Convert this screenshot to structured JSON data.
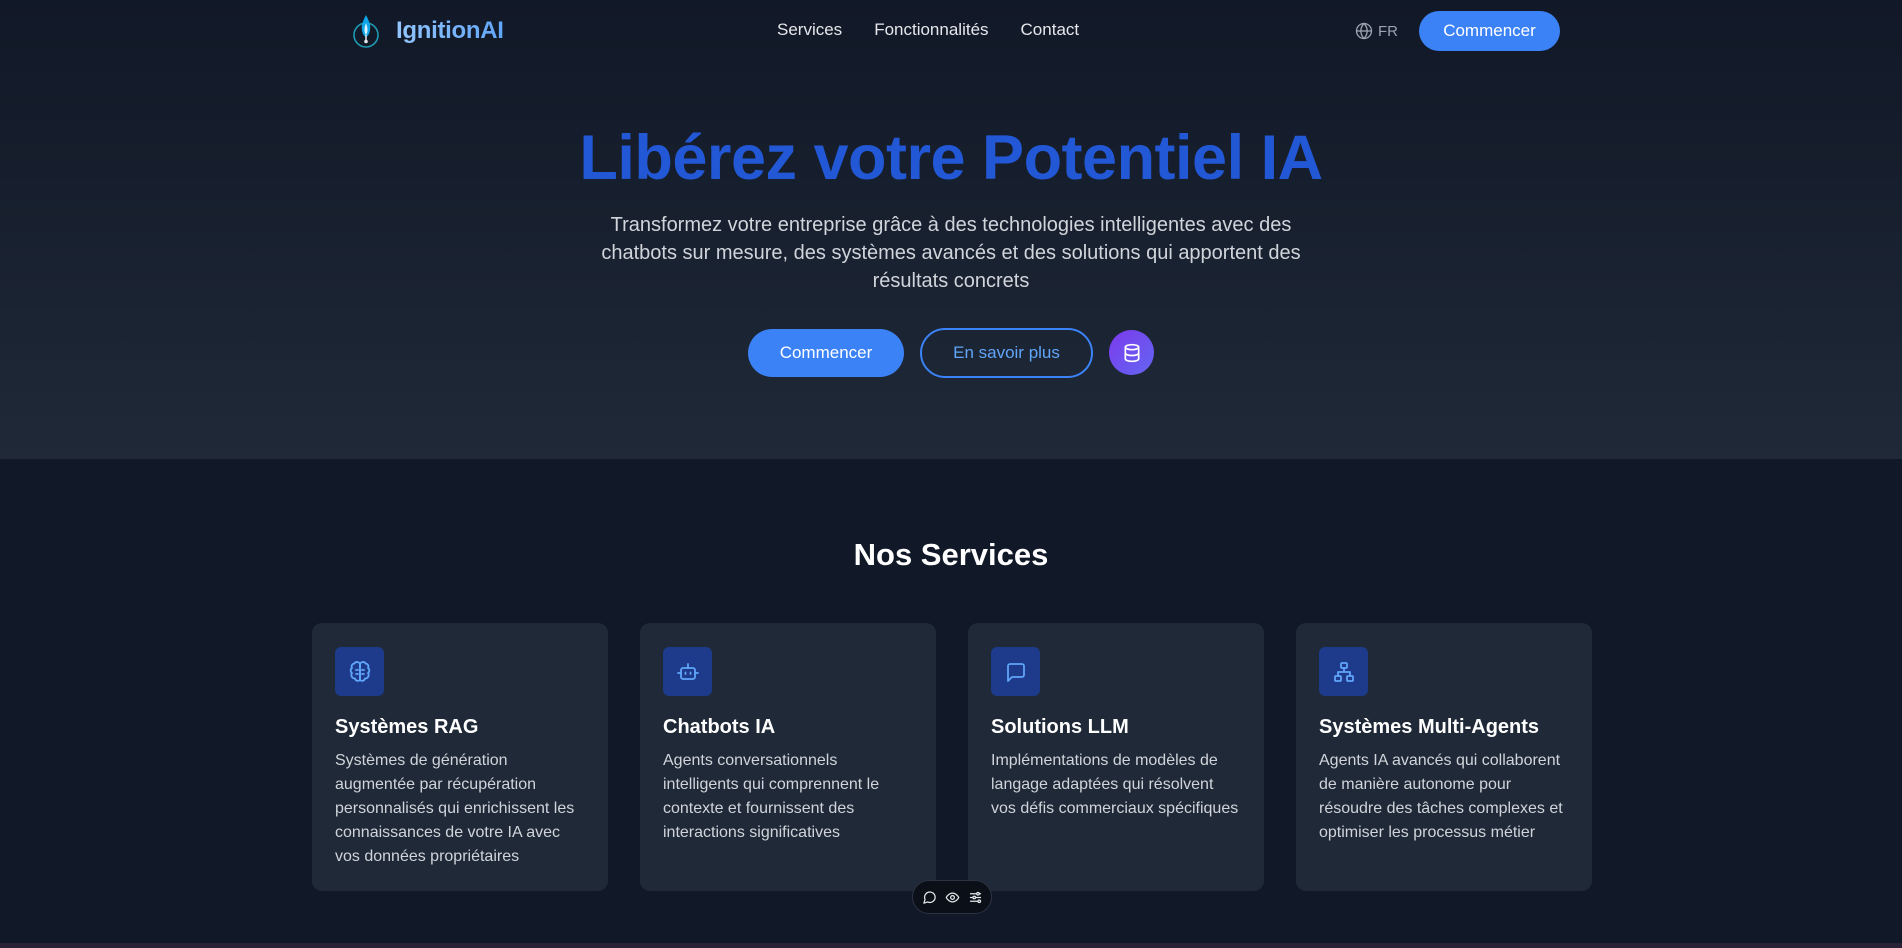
{
  "nav": {
    "logo_text": "IgnitionAI",
    "links": [
      "Services",
      "Fonctionnalités",
      "Contact"
    ],
    "language": "FR",
    "cta": "Commencer"
  },
  "hero": {
    "title": "Libérez votre Potentiel IA",
    "subtitle": "Transformez votre entreprise grâce à des technologies intelligentes avec des chatbots sur mesure, des systèmes avancés et des solutions qui apportent des résultats concrets",
    "primary_button": "Commencer",
    "secondary_button": "En savoir plus",
    "icon_button": "database-icon"
  },
  "services": {
    "title": "Nos Services",
    "cards": [
      {
        "icon": "brain-icon",
        "title": "Systèmes RAG",
        "description": "Systèmes de génération augmentée par récupération personnalisés qui enrichissent les connaissances de votre IA avec vos données propriétaires"
      },
      {
        "icon": "bot-icon",
        "title": "Chatbots IA",
        "description": "Agents conversationnels intelligents qui comprennent le contexte et fournissent des interactions significatives"
      },
      {
        "icon": "message-square-icon",
        "title": "Solutions LLM",
        "description": "Implémentations de modèles de langage adaptées qui résolvent vos défis commerciaux spécifiques"
      },
      {
        "icon": "network-icon",
        "title": "Systèmes Multi-Agents",
        "description": "Agents IA avancés qui collaborent de manière autonome pour résoudre des tâches complexes et optimiser les processus métier"
      }
    ]
  },
  "floating_toolbar": {
    "icons": [
      "chat-bubble-icon",
      "eye-icon",
      "sliders-icon"
    ]
  },
  "colors": {
    "accent": "#3b82f6",
    "title_blue": "#2258d6",
    "background": "#111827",
    "card": "#1f2937"
  }
}
